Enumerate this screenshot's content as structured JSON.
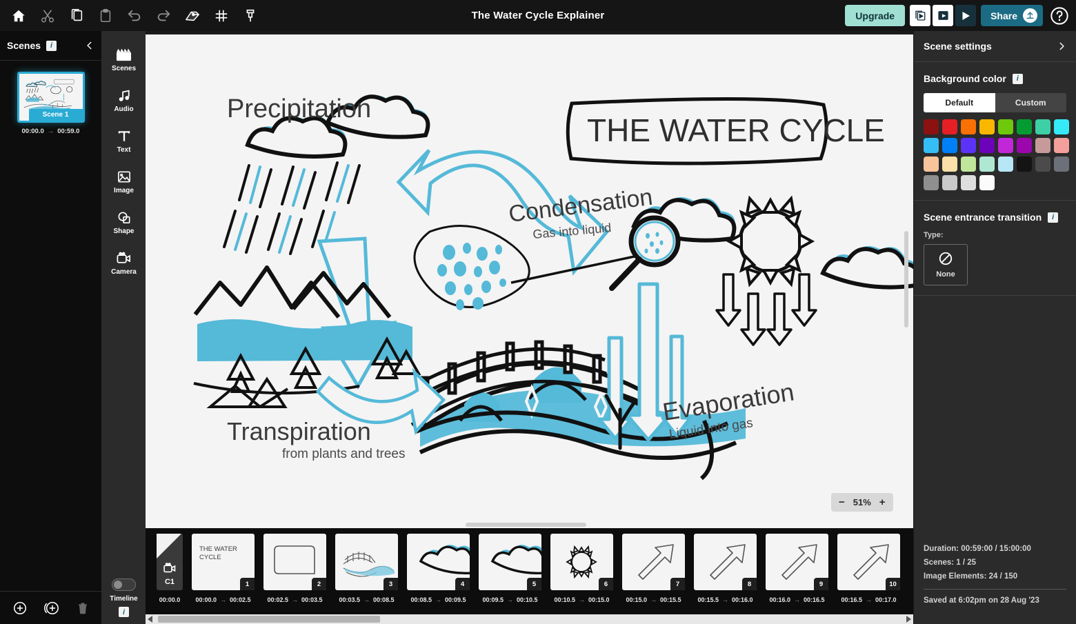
{
  "topbar": {
    "title": "The Water Cycle Explainer",
    "tools": [
      {
        "name": "home-icon",
        "label": "Home"
      },
      {
        "name": "cut-icon",
        "label": "Cut"
      },
      {
        "name": "copy-icon",
        "label": "Copy"
      },
      {
        "name": "paste-icon",
        "label": "Paste"
      },
      {
        "name": "undo-icon",
        "label": "Undo"
      },
      {
        "name": "redo-icon",
        "label": "Redo"
      },
      {
        "name": "draw-hand-icon",
        "label": "Drawing hand"
      },
      {
        "name": "grid-icon",
        "label": "Grid"
      },
      {
        "name": "pin-icon",
        "label": "Pin"
      }
    ],
    "upgrade_label": "Upgrade",
    "share_label": "Share",
    "playback": [
      "preview-scene-icon",
      "play-scene-icon",
      "play-all-icon"
    ],
    "help_icon": "question-mark-icon"
  },
  "scenes_panel": {
    "title": "Scenes",
    "info_badge": "i",
    "collapse_icon": "chevron-left-icon",
    "scene": {
      "label": "Scene 1",
      "start": "00:00.0",
      "arrow": "→",
      "end": "00:59.0"
    },
    "actions": [
      {
        "name": "add-scene-button",
        "label": "Add scene"
      },
      {
        "name": "duplicate-scene-button",
        "label": "Duplicate scene"
      },
      {
        "name": "delete-scene-button",
        "label": "Delete scene"
      }
    ]
  },
  "tool_rail": {
    "items": [
      {
        "label": "Scenes",
        "icon": "clapperboard-icon"
      },
      {
        "label": "Audio",
        "icon": "music-note-icon"
      },
      {
        "label": "Text",
        "icon": "text-t-icon"
      },
      {
        "label": "Image",
        "icon": "image-icon"
      },
      {
        "label": "Shape",
        "icon": "shapes-icon"
      },
      {
        "label": "Camera",
        "icon": "camera-icon"
      }
    ],
    "timeline_label": "Timeline",
    "timeline_info": "i",
    "timeline_toggle_state": "off"
  },
  "canvas": {
    "zoom_level": "51%",
    "zoom_out": "−",
    "zoom_in": "+",
    "labels": {
      "title_box": "THE WATER CYCLE",
      "precipitation": "Precipitation",
      "condensation": "Condensation",
      "condensation_sub": "Gas into liquid",
      "evaporation": "Evaporation",
      "evaporation_sub": "Liquid into gas",
      "transpiration": "Transpiration",
      "transpiration_sub": "from plants and trees"
    },
    "accent_color": "#55b9d8",
    "ink_color": "#111111",
    "background_color": "#f4f4f4"
  },
  "timeline": {
    "cursor": {
      "label": "C1",
      "time": "00:00.0",
      "icon": "camera-icon"
    },
    "frames": [
      {
        "num": "1",
        "start": "00:00.0",
        "end": "00:02.5",
        "kind": "text",
        "text": "THE WATER\nCYCLE"
      },
      {
        "num": "2",
        "start": "00:02.5",
        "end": "00:03.5",
        "kind": "box"
      },
      {
        "num": "3",
        "start": "00:03.5",
        "end": "00:08.5",
        "kind": "landscape"
      },
      {
        "num": "4",
        "start": "00:08.5",
        "end": "00:09.5",
        "kind": "cloud"
      },
      {
        "num": "5",
        "start": "00:09.5",
        "end": "00:10.5",
        "kind": "cloud"
      },
      {
        "num": "6",
        "start": "00:10.5",
        "end": "00:15.0",
        "kind": "sun"
      },
      {
        "num": "7",
        "start": "00:15.0",
        "end": "00:15.5",
        "kind": "arrow"
      },
      {
        "num": "8",
        "start": "00:15.5",
        "end": "00:16.0",
        "kind": "arrow"
      },
      {
        "num": "9",
        "start": "00:16.0",
        "end": "00:16.5",
        "kind": "arrow"
      },
      {
        "num": "10",
        "start": "00:16.5",
        "end": "00:17.0",
        "kind": "arrow"
      }
    ],
    "arrow_left": "◀",
    "arrow_right": "▶"
  },
  "right_panel": {
    "header": "Scene settings",
    "header_chevron": "chevron-right-icon",
    "background_color": {
      "label": "Background color",
      "info": "i",
      "tabs": {
        "default": "Default",
        "custom": "Custom",
        "selected": "Default"
      },
      "swatches": [
        "#8c1111",
        "#e61f24",
        "#f97004",
        "#f9b700",
        "#6ec80c",
        "#049b32",
        "#3dcfa5",
        "#36e9f6",
        "#35bdf6",
        "#0080f6",
        "#5c33f6",
        "#6c03ba",
        "#c226d9",
        "#9b06ad",
        "#c69a9a",
        "#f3a09c",
        "#f9c49a",
        "#fbe0a7",
        "#bfe69a",
        "#aee8d3",
        "#b7e6f6",
        "#141414",
        "#4b4b4b",
        "#6c7078",
        "#8f8f8f",
        "#c9c9c9",
        "#dedede",
        "#fbfbfb"
      ]
    },
    "entrance_transition": {
      "label": "Scene entrance transition",
      "info": "i",
      "type_label": "Type:",
      "selected": "None",
      "selected_icon": "no-entry-icon"
    },
    "stats": {
      "duration": "Duration: 00:59:00 / 15:00:00",
      "scenes": "Scenes: 1 / 25",
      "image_elements": "Image Elements: 24 / 150",
      "saved": "Saved at 6:02pm on 28 Aug '23"
    }
  }
}
